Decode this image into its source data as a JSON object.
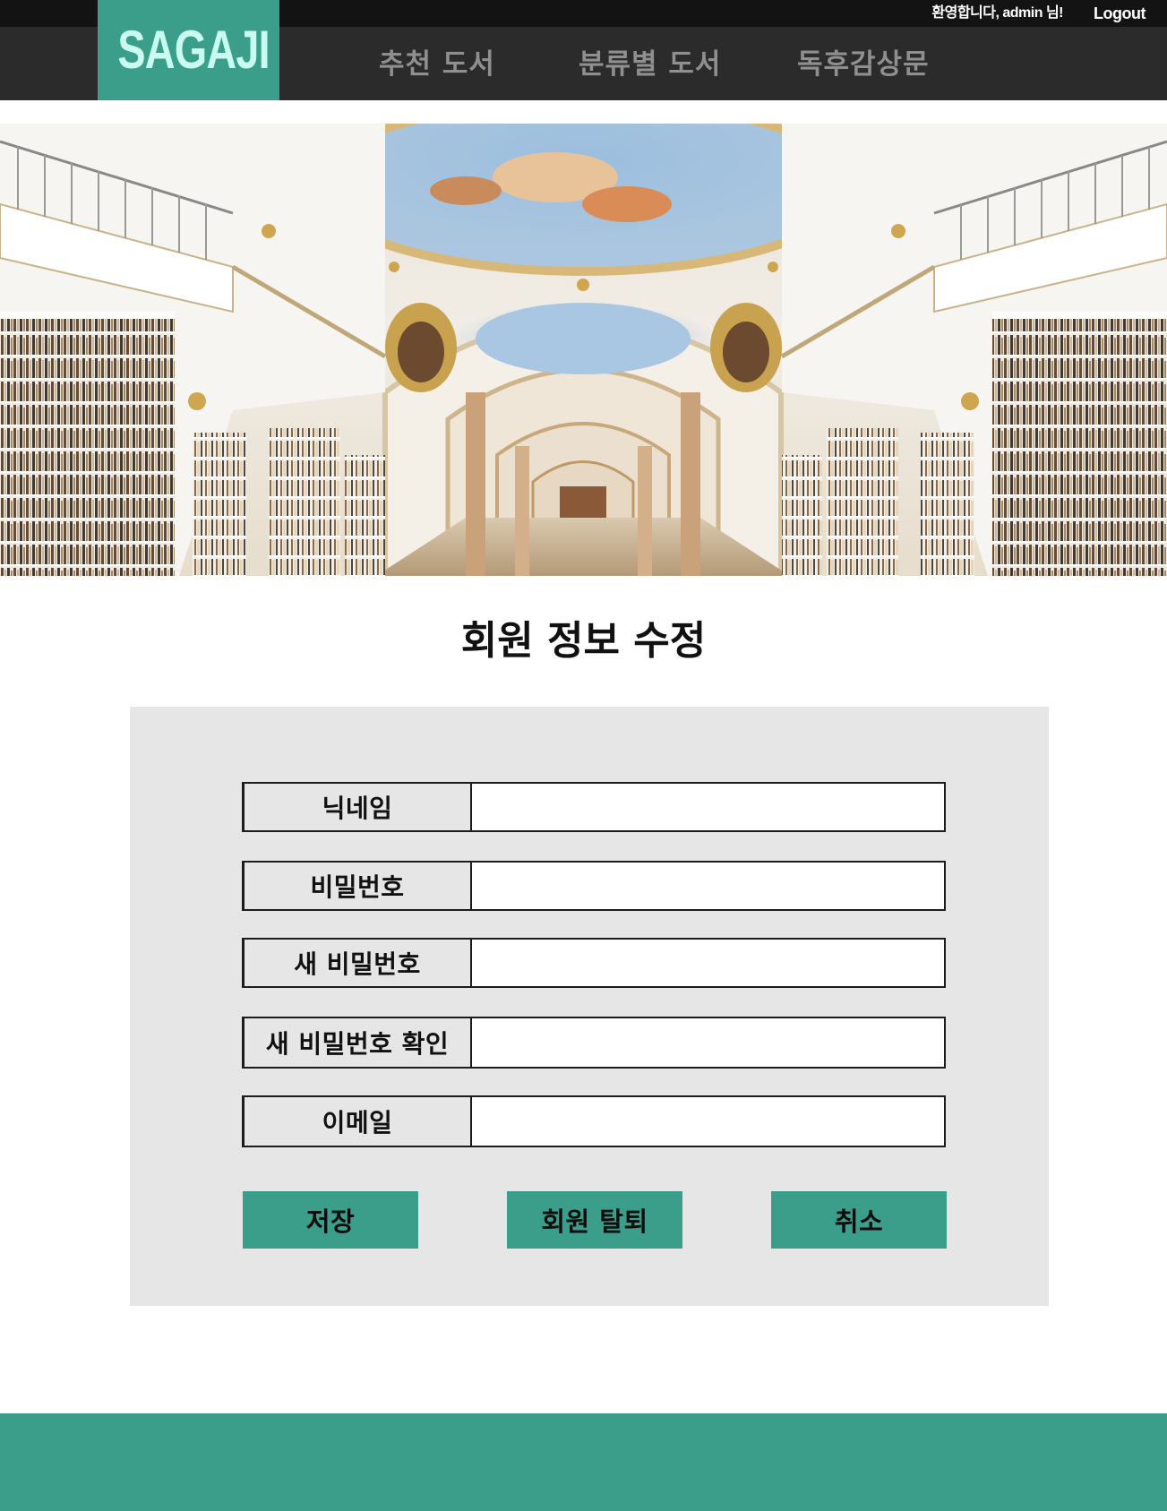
{
  "header": {
    "welcome_text": "환영합니다, admin 님!",
    "logout_label": "Logout",
    "logo_text": "SAGAJI",
    "nav_items": [
      {
        "label": "추천 도서"
      },
      {
        "label": "분류별 도서"
      },
      {
        "label": "독후감상문"
      }
    ]
  },
  "hero": {
    "image": "ornate-library-hall"
  },
  "page": {
    "title": "회원 정보 수정"
  },
  "form": {
    "fields": [
      {
        "label": "닉네임",
        "value": "",
        "placeholder": ""
      },
      {
        "label": "비밀번호",
        "value": "",
        "placeholder": ""
      },
      {
        "label": "새 비밀번호",
        "value": "",
        "placeholder": ""
      },
      {
        "label": "새 비밀번호 확인",
        "value": "",
        "placeholder": ""
      },
      {
        "label": "이메일",
        "value": "",
        "placeholder": ""
      }
    ],
    "buttons": {
      "save": "저장",
      "withdraw": "회원 탈퇴",
      "cancel": "취소"
    }
  },
  "colors": {
    "accent": "#3a9e8a",
    "topbar": "#131313",
    "navbar": "#2b2b2b",
    "nav_text": "#8f8f8f",
    "panel": "#e6e6e6",
    "logo_text": "#c9fbf0"
  }
}
